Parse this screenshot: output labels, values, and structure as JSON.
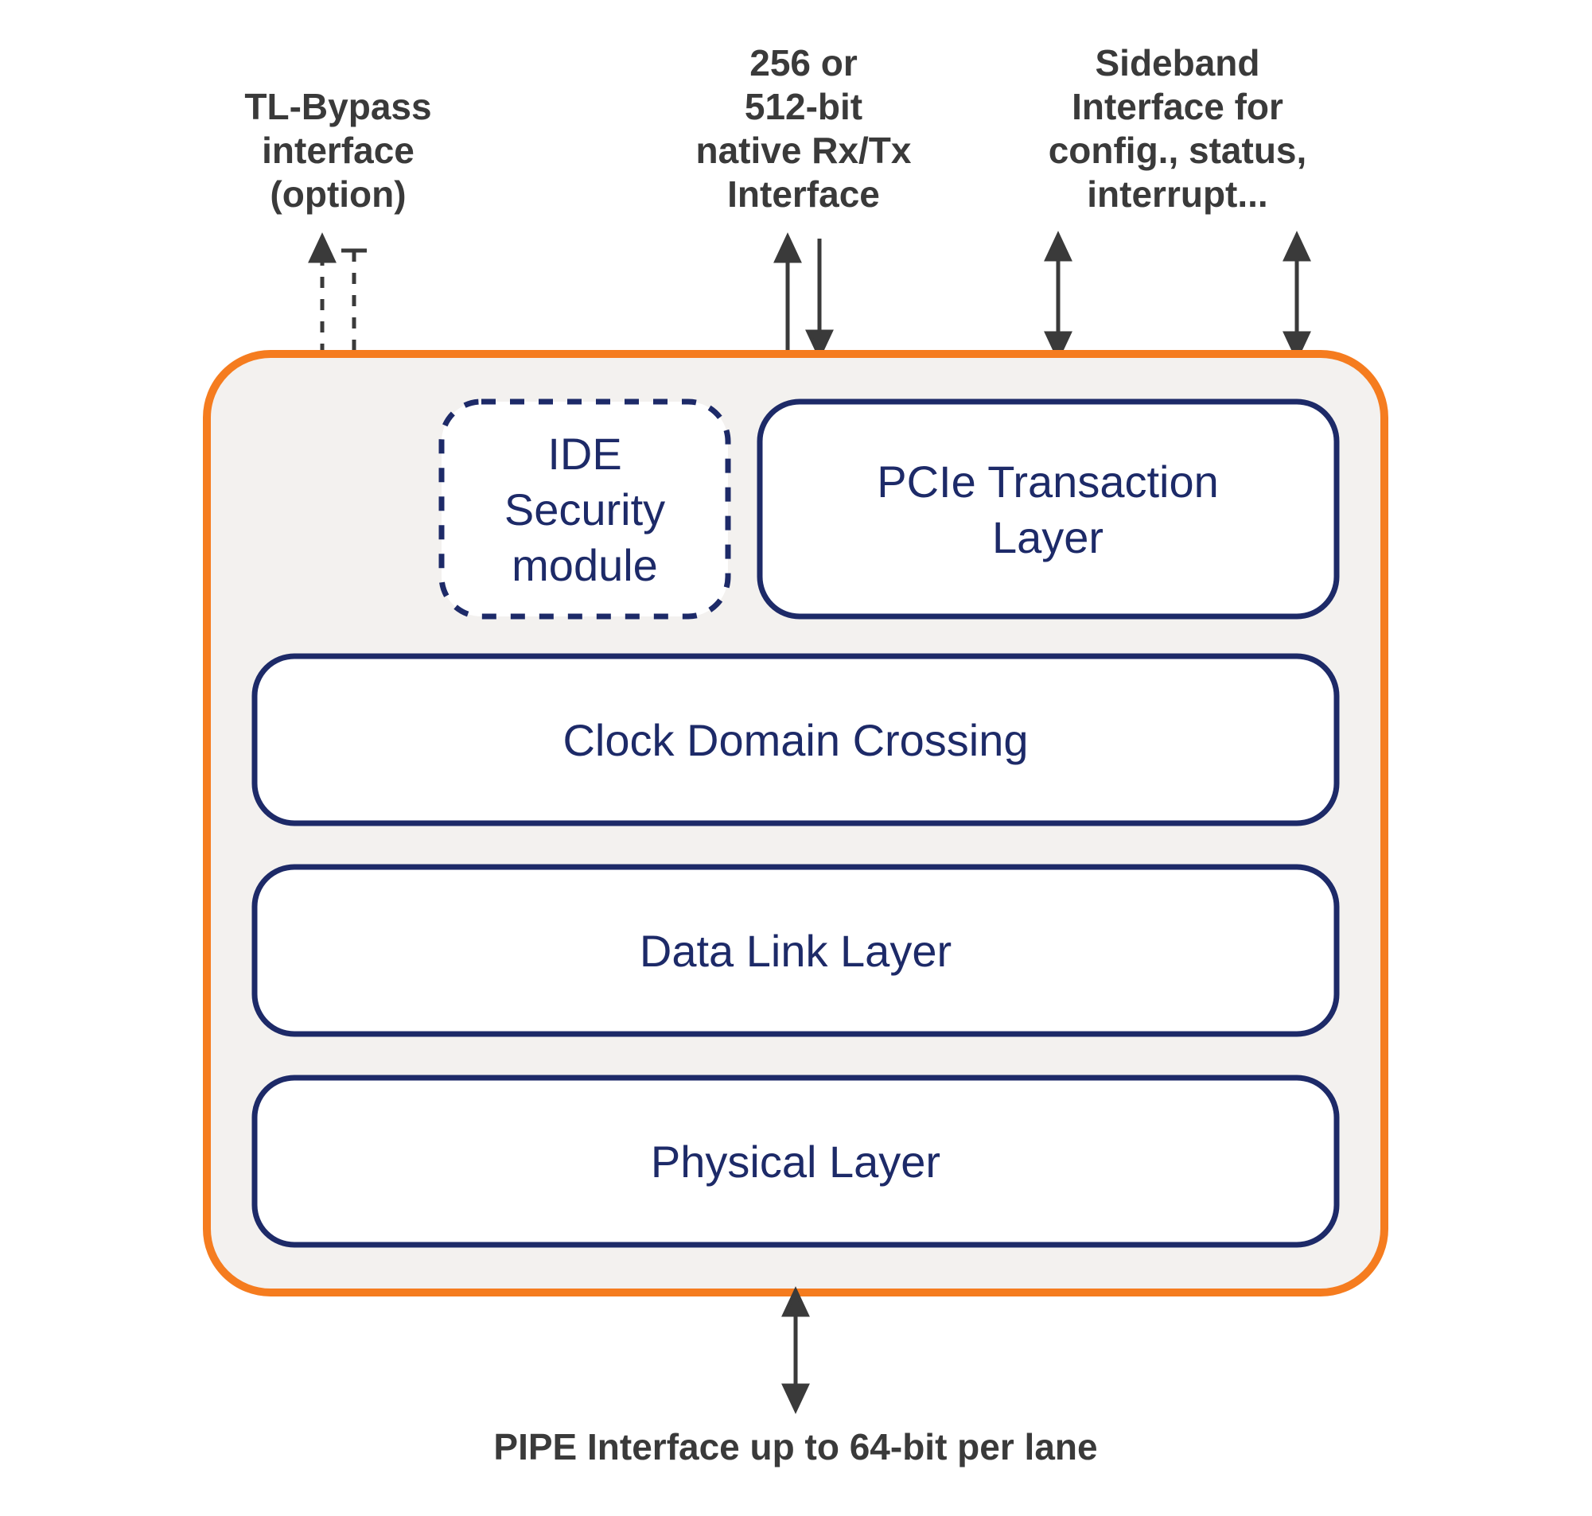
{
  "labels": {
    "tl_bypass_l1": "TL-Bypass",
    "tl_bypass_l2": "interface",
    "tl_bypass_l3": "(option)",
    "native_l1": "256 or",
    "native_l2": "512-bit",
    "native_l3": "native Rx/Tx",
    "native_l4": "Interface",
    "sideband_l1": "Sideband",
    "sideband_l2": "Interface for",
    "sideband_l3": "config., status,",
    "sideband_l4": "interrupt...",
    "bottom": "PIPE Interface up to 64-bit per lane"
  },
  "blocks": {
    "ide_l1": "IDE",
    "ide_l2": "Security",
    "ide_l3": "module",
    "txn_l1": "PCIe Transaction",
    "txn_l2": "Layer",
    "cdc": "Clock Domain Crossing",
    "dll": "Data Link Layer",
    "phy": "Physical Layer"
  },
  "colors": {
    "outer_stroke": "#f57c1f",
    "inner_fill": "#f3f1ef",
    "block_stroke": "#1d2a68",
    "block_fill": "#ffffff",
    "text_dark": "#3a3a3a",
    "text_navy": "#1d2a68",
    "arrow": "#3a3a3a"
  }
}
